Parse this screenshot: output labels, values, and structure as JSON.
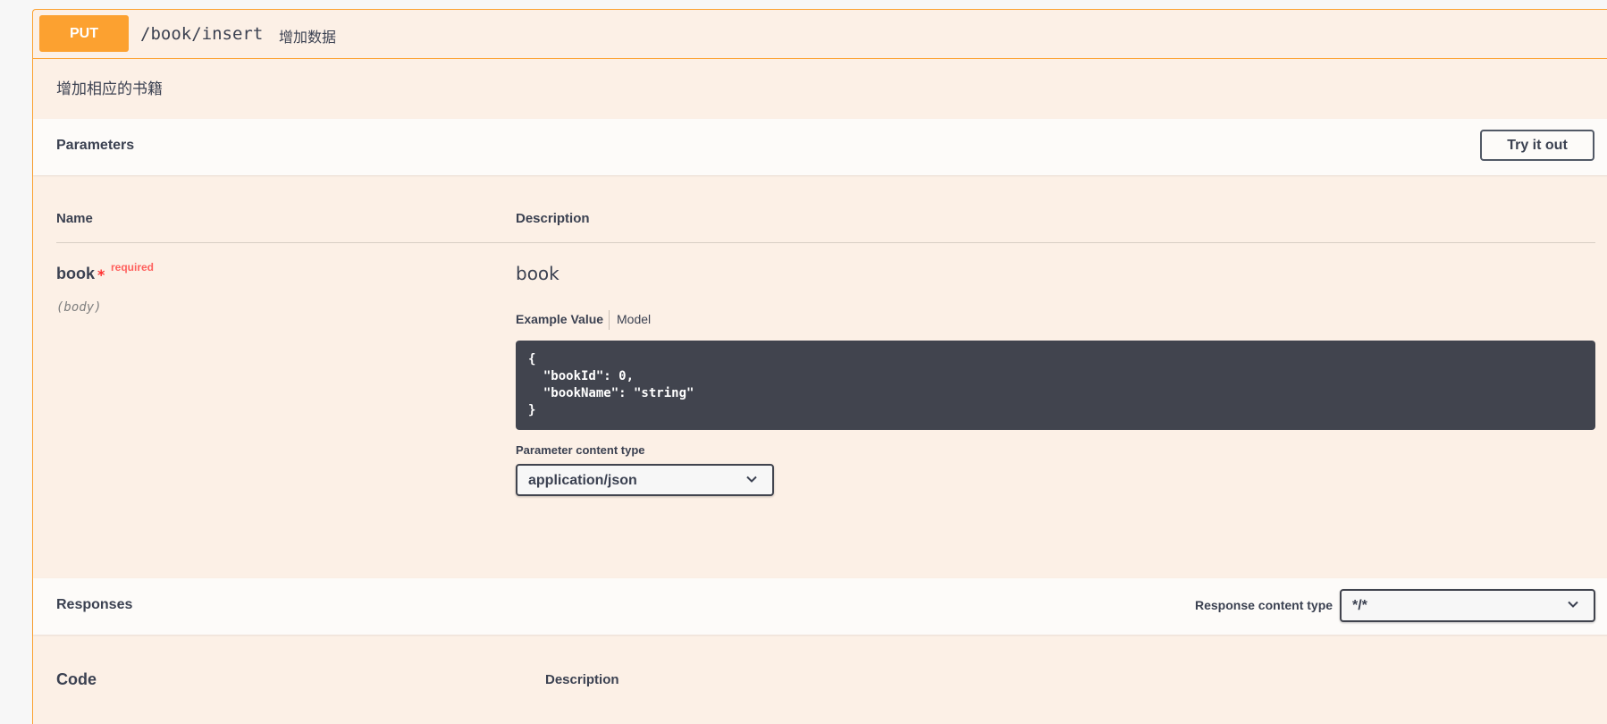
{
  "operation": {
    "method": "PUT",
    "path": "/book/insert",
    "summary": "增加数据",
    "description": "增加相应的书籍"
  },
  "parameters": {
    "title": "Parameters",
    "try_button": "Try it out",
    "col_name": "Name",
    "col_description": "Description",
    "items": [
      {
        "name": "book",
        "star": "*",
        "required": "required",
        "in": "(body)",
        "description": "book",
        "tab_example": "Example Value",
        "tab_model": "Model",
        "example": "{\n  \"bookId\": 0,\n  \"bookName\": \"string\"\n}",
        "content_type_label": "Parameter content type",
        "content_type": "application/json"
      }
    ]
  },
  "responses": {
    "title": "Responses",
    "content_type_label": "Response content type",
    "content_type": "*/*",
    "col_code": "Code",
    "col_description": "Description"
  },
  "colors": {
    "method_put": "#fca130",
    "block_bg": "#fcf0e6",
    "code_bg": "#41444e",
    "required": "#ff2f2f"
  }
}
